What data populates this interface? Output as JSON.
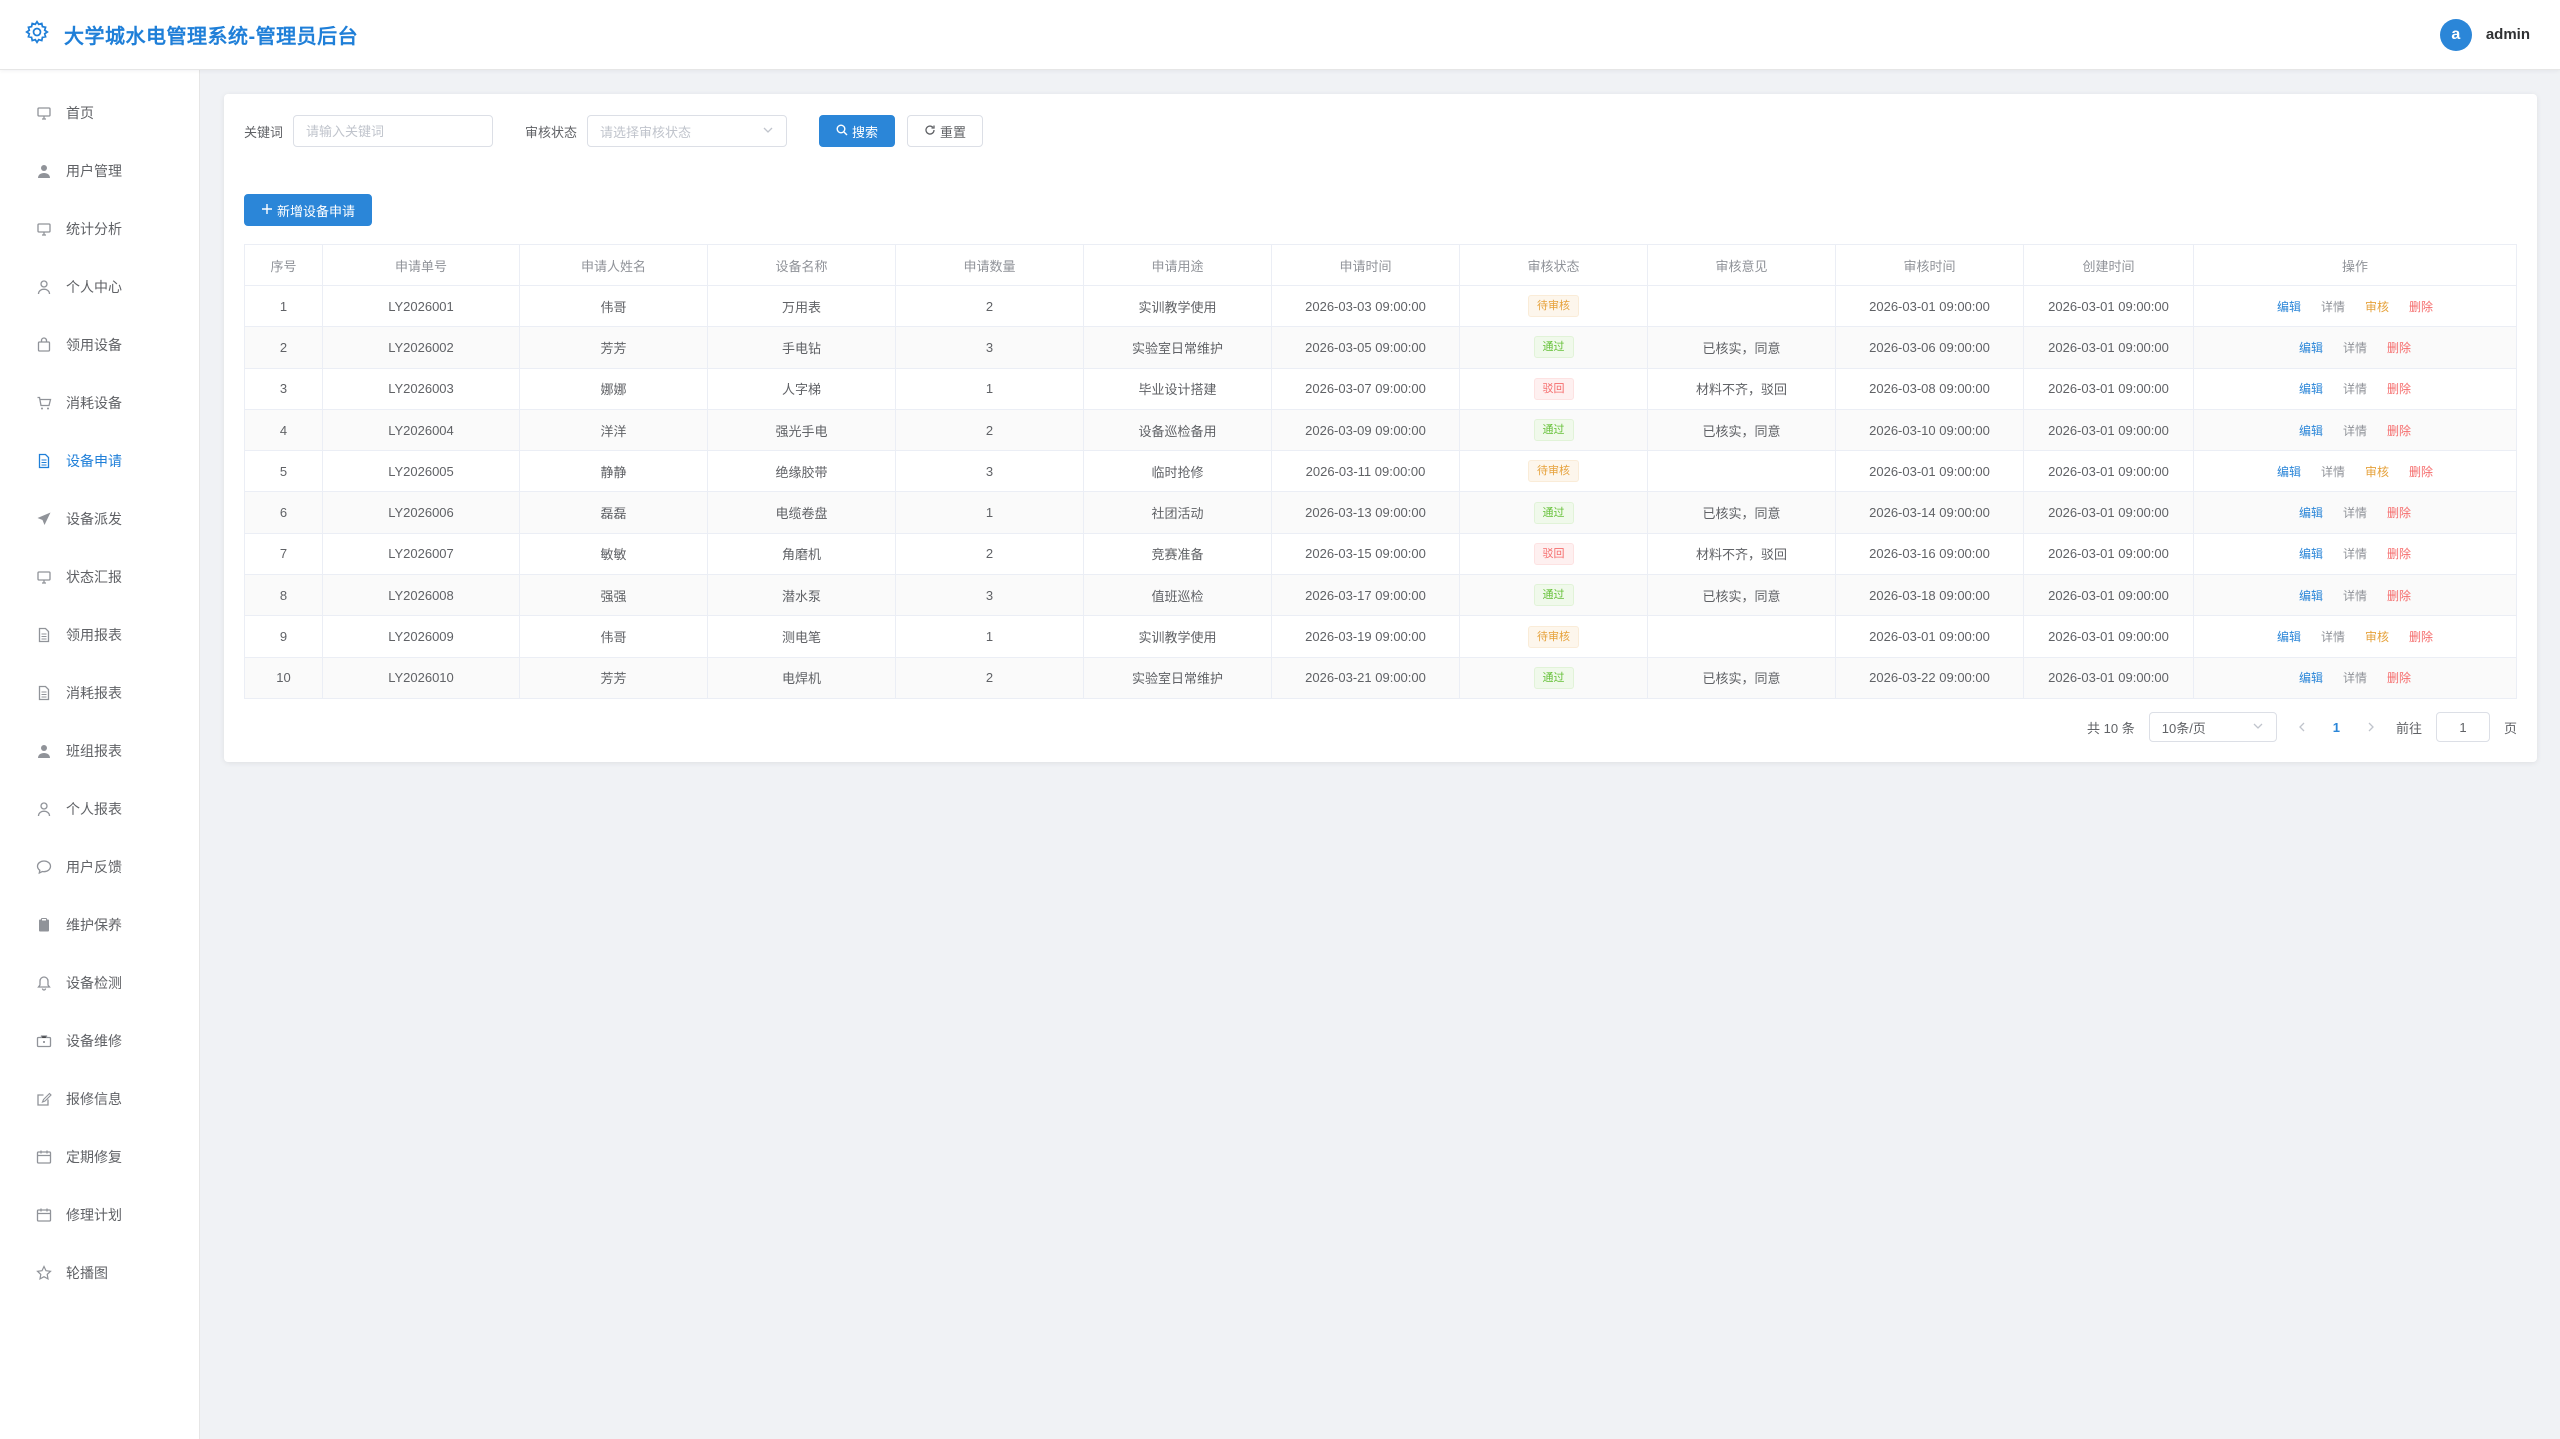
{
  "header": {
    "title": "大学城水电管理系统-管理员后台",
    "avatar_letter": "a",
    "username": "admin"
  },
  "sidebar": {
    "items": [
      {
        "label": "首页",
        "icon": "monitor-icon",
        "active": false
      },
      {
        "label": "用户管理",
        "icon": "user-icon",
        "active": false
      },
      {
        "label": "统计分析",
        "icon": "monitor-icon",
        "active": false
      },
      {
        "label": "个人中心",
        "icon": "user-outline-icon",
        "active": false
      },
      {
        "label": "领用设备",
        "icon": "bag-icon",
        "active": false
      },
      {
        "label": "消耗设备",
        "icon": "cart-icon",
        "active": false
      },
      {
        "label": "设备申请",
        "icon": "document-icon",
        "active": true
      },
      {
        "label": "设备派发",
        "icon": "send-icon",
        "active": false
      },
      {
        "label": "状态汇报",
        "icon": "monitor-icon",
        "active": false
      },
      {
        "label": "领用报表",
        "icon": "document-icon",
        "active": false
      },
      {
        "label": "消耗报表",
        "icon": "document-icon",
        "active": false
      },
      {
        "label": "班组报表",
        "icon": "user-icon",
        "active": false
      },
      {
        "label": "个人报表",
        "icon": "user-outline-icon",
        "active": false
      },
      {
        "label": "用户反馈",
        "icon": "chat-icon",
        "active": false
      },
      {
        "label": "维护保养",
        "icon": "clipboard-icon",
        "active": false
      },
      {
        "label": "设备检测",
        "icon": "bell-icon",
        "active": false
      },
      {
        "label": "设备维修",
        "icon": "briefcase-icon",
        "active": false
      },
      {
        "label": "报修信息",
        "icon": "edit-icon",
        "active": false
      },
      {
        "label": "定期修复",
        "icon": "calendar-icon",
        "active": false
      },
      {
        "label": "修理计划",
        "icon": "calendar-icon",
        "active": false
      },
      {
        "label": "轮播图",
        "icon": "star-icon",
        "active": false
      }
    ]
  },
  "filters": {
    "keyword_label": "关键词",
    "keyword_placeholder": "请输入关键词",
    "status_label": "审核状态",
    "status_placeholder": "请选择审核状态",
    "search_label": "搜索",
    "reset_label": "重置"
  },
  "add_button_label": "新增设备申请",
  "table": {
    "columns": [
      "序号",
      "申请单号",
      "申请人姓名",
      "设备名称",
      "申请数量",
      "申请用途",
      "申请时间",
      "审核状态",
      "审核意见",
      "审核时间",
      "创建时间",
      "操作"
    ],
    "rows": [
      [
        "1",
        "LY2026001",
        "伟哥",
        "万用表",
        "2",
        "实训教学使用",
        "2026-03-03 09:00:00",
        "待审核",
        "",
        "2026-03-01 09:00:00",
        "2026-03-01 09:00:00"
      ],
      [
        "2",
        "LY2026002",
        "芳芳",
        "手电钻",
        "3",
        "实验室日常维护",
        "2026-03-05 09:00:00",
        "通过",
        "已核实，同意",
        "2026-03-06 09:00:00",
        "2026-03-01 09:00:00"
      ],
      [
        "3",
        "LY2026003",
        "娜娜",
        "人字梯",
        "1",
        "毕业设计搭建",
        "2026-03-07 09:00:00",
        "驳回",
        "材料不齐，驳回",
        "2026-03-08 09:00:00",
        "2026-03-01 09:00:00"
      ],
      [
        "4",
        "LY2026004",
        "洋洋",
        "强光手电",
        "2",
        "设备巡检备用",
        "2026-03-09 09:00:00",
        "通过",
        "已核实，同意",
        "2026-03-10 09:00:00",
        "2026-03-01 09:00:00"
      ],
      [
        "5",
        "LY2026005",
        "静静",
        "绝缘胶带",
        "3",
        "临时抢修",
        "2026-03-11 09:00:00",
        "待审核",
        "",
        "2026-03-01 09:00:00",
        "2026-03-01 09:00:00"
      ],
      [
        "6",
        "LY2026006",
        "磊磊",
        "电缆卷盘",
        "1",
        "社团活动",
        "2026-03-13 09:00:00",
        "通过",
        "已核实，同意",
        "2026-03-14 09:00:00",
        "2026-03-01 09:00:00"
      ],
      [
        "7",
        "LY2026007",
        "敏敏",
        "角磨机",
        "2",
        "竞赛准备",
        "2026-03-15 09:00:00",
        "驳回",
        "材料不齐，驳回",
        "2026-03-16 09:00:00",
        "2026-03-01 09:00:00"
      ],
      [
        "8",
        "LY2026008",
        "强强",
        "潜水泵",
        "3",
        "值班巡检",
        "2026-03-17 09:00:00",
        "通过",
        "已核实，同意",
        "2026-03-18 09:00:00",
        "2026-03-01 09:00:00"
      ],
      [
        "9",
        "LY2026009",
        "伟哥",
        "测电笔",
        "1",
        "实训教学使用",
        "2026-03-19 09:00:00",
        "待审核",
        "",
        "2026-03-01 09:00:00",
        "2026-03-01 09:00:00"
      ],
      [
        "10",
        "LY2026010",
        "芳芳",
        "电焊机",
        "2",
        "实验室日常维护",
        "2026-03-21 09:00:00",
        "通过",
        "已核实，同意",
        "2026-03-22 09:00:00",
        "2026-03-01 09:00:00"
      ]
    ],
    "ops": {
      "edit": "编辑",
      "detail": "详情",
      "audit": "审核",
      "delete": "删除"
    }
  },
  "pagination": {
    "total_text": "共 10 条",
    "page_size": "10条/页",
    "current_page": "1",
    "goto_label": "前往",
    "goto_value": "1",
    "page_unit": "页"
  },
  "colors": {
    "primary": "#2b86d8",
    "pending": "#e6a23c",
    "pass": "#67c23a",
    "reject": "#f56c6c"
  }
}
